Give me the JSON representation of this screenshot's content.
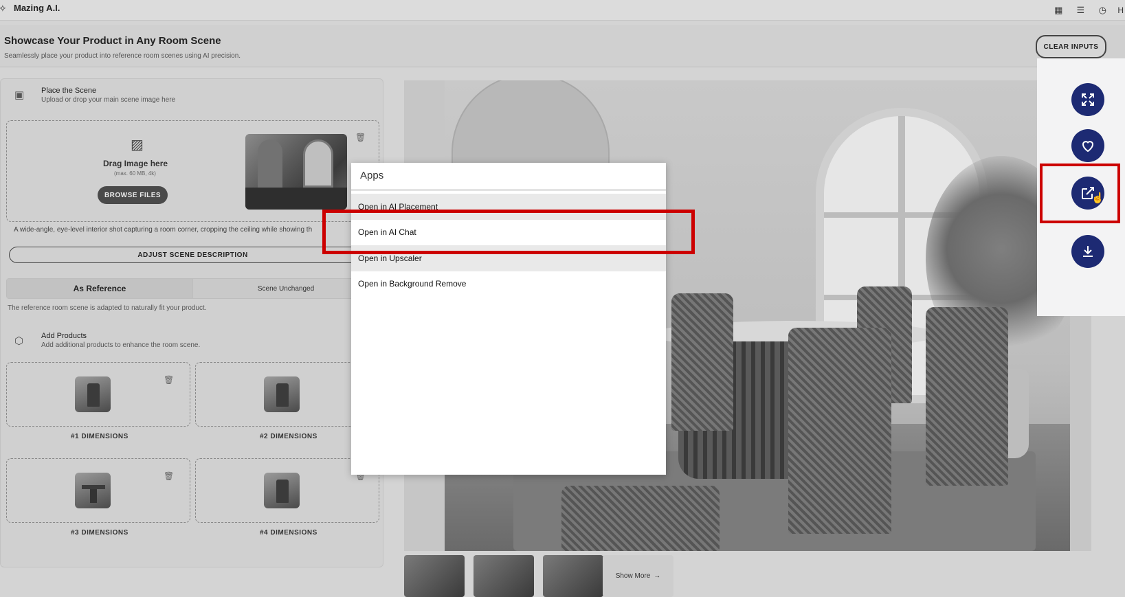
{
  "app": {
    "title": "Mazing A.I.",
    "logo_icon": "sparkle-icon",
    "top_hint": "H"
  },
  "header": {
    "title": "Showcase Your Product in Any Room Scene",
    "subtitle": "Seamlessly place your product into reference room scenes using AI precision.",
    "clear_label": "CLEAR INPUTS"
  },
  "scene": {
    "title": "Place the Scene",
    "subtitle": "Upload or drop your main scene image here",
    "drag_title": "Drag Image here",
    "drag_note": "(max. 60 MB, 4k)",
    "browse_label": "BROWSE FILES",
    "description": "A wide-angle, eye-level interior shot capturing a room corner, cropping the ceiling while showing th",
    "adjust_label": "ADJUST SCENE DESCRIPTION"
  },
  "mode": {
    "options": [
      "As Reference",
      "Scene Unchanged"
    ],
    "selected": "As Reference",
    "note": "The reference room scene is adapted to naturally fit your product."
  },
  "products": {
    "title": "Add Products",
    "subtitle": "Add additional products to enhance the room scene.",
    "items": [
      {
        "label": "#1 DIMENSIONS"
      },
      {
        "label": "#2 DIMENSIONS"
      },
      {
        "label": "#3 DIMENSIONS"
      },
      {
        "label": "#4 DIMENSIONS"
      }
    ]
  },
  "gallery": {
    "show_more_label": "Show More",
    "show_more_icon": "arrow-right-icon"
  },
  "actions": {
    "buttons": [
      "expand-icon",
      "heart-icon",
      "open-external-icon",
      "download-icon"
    ],
    "accent_color": "#1d2a73"
  },
  "apps_menu": {
    "title": "Apps",
    "items": [
      "Open in AI Placement",
      "Open in AI Chat",
      "Open in Upscaler",
      "Open in Background Remove"
    ],
    "highlighted": "Open in AI Chat",
    "highlight_color": "#cc0000"
  }
}
